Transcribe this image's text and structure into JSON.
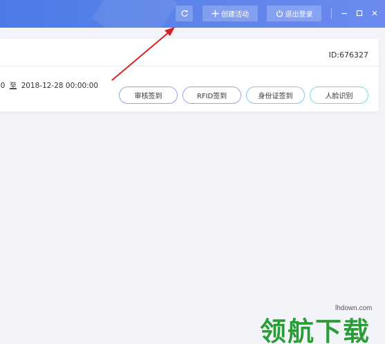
{
  "header": {
    "refresh_icon": "refresh-icon",
    "create_label": "创建活动",
    "logout_label": "退出登录",
    "accent": "#5680e9"
  },
  "card": {
    "id_label": "ID:676327",
    "time_start": "00",
    "time_sep": "至",
    "time_end": "2018-12-28 00:00:00",
    "actions": {
      "audit": "审核签到",
      "rfid": "RFID签到",
      "idcard": "身份证签到",
      "face": "人脸识别"
    }
  },
  "watermark": {
    "url": "lhdown.com",
    "text": "领航下载"
  }
}
